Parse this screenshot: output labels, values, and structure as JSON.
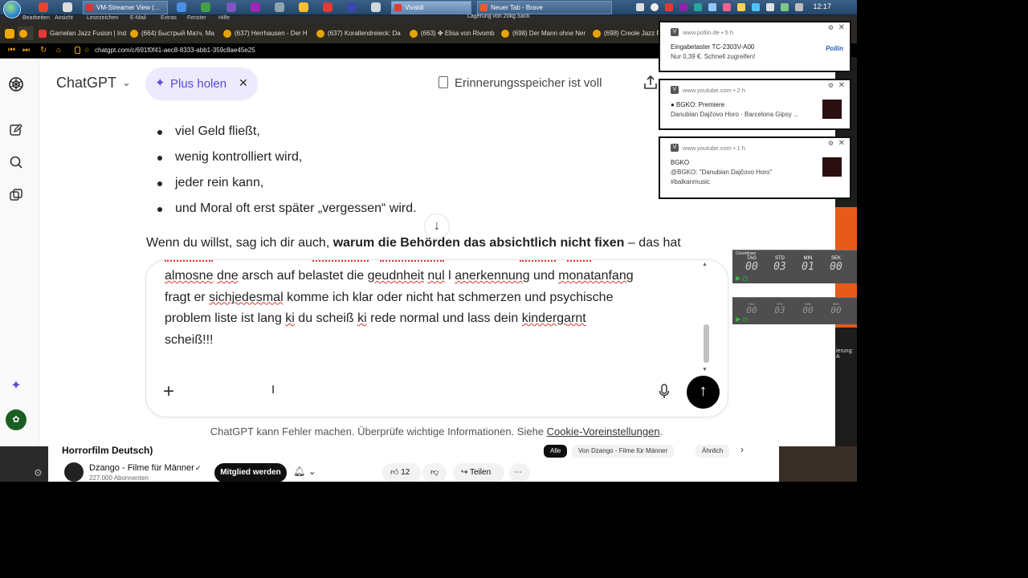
{
  "taskbar": {
    "tasks": [
      "VM-Streamer View (...",
      "Vivaldi",
      "Neuer Tab - Brave"
    ],
    "clock": "12:17",
    "window_title_snip": "Lagerung von 20kg Sack"
  },
  "menubar": {
    "items": [
      "Bearbeiten",
      "Ansicht",
      "Lesezeichen",
      "E-Mail",
      "Extras",
      "Fenster",
      "Hilfe"
    ]
  },
  "tabs": [
    "Gamelan Jazz Fusion | Ind",
    "(664) Быстрый Матч. Ma",
    "(637) Herrhausen - Der H",
    "(637) Korallendreieck: Da",
    "(663) ✤ Elisa von Rivomb",
    "(698) Der Mann ohne Ner",
    "(698) Creole Jazz F"
  ],
  "address": {
    "url": "chatgpt.com/c/691f0f41-aec8-8333-abb1-359c8ae45e25"
  },
  "chat": {
    "model_name": "ChatGPT",
    "plus_label": "Plus holen",
    "memory_label": "Erinnerungsspeicher ist voll",
    "bullets": [
      "viel Geld fließt,",
      "wenig kontrolliert wird,",
      "jeder rein kann,",
      "und Moral oft erst später „vergessen“ wird."
    ],
    "para_prefix": "Wenn du willst, sag ich dir auch, ",
    "para_bold": "warum die Behörden das absichtlich nicht fixen",
    "para_suffix": " – das hat",
    "input_lines": {
      "l1_a": "almosne",
      "l1_b": " ",
      "l1_c": "dne",
      "l1_d": " arsch auf belastet die ",
      "l1_e": "geudnheit",
      "l1_f": " ",
      "l1_g": "nul",
      "l1_h": " l ",
      "l1_i": "anerkennung",
      "l1_j": " und  ",
      "l1_k": "monatanfang",
      "l2_a": "fragt er ",
      "l2_b": "sichjedesmal",
      "l2_c": "  komme ich klar oder nicht  hat schmerzen und psychische",
      "l3_a": "problem liste ist lang ",
      "l3_b": "ki",
      "l3_c": " du scheiß ",
      "l3_d": "ki",
      "l3_e": " rede normal  und lass dein ",
      "l3_f": "kindergarnt",
      "l4": "scheiß!!!"
    },
    "disclaimer_prefix": "ChatGPT kann Fehler machen. Überprüfe wichtige Informationen. Siehe ",
    "disclaimer_link": "Cookie-Voreinstellungen",
    "disclaimer_suffix": "."
  },
  "youtube": {
    "title_snip": "Horrorfilm Deutsch)",
    "channel": "Dzango - Filme für Männer",
    "subscribers": "227.000 Abonnenten",
    "join_label": "Mitglied werden",
    "likes": "12",
    "share_label": "Teilen",
    "chips": [
      "Alle",
      "Von Dzango - Filme für Männer",
      "Ähnlich"
    ]
  },
  "notifications": [
    {
      "source": "www.pollin.de • 5 h",
      "line1": "Eingabetaster TC-2303V-A00",
      "line2": "Nur 0,39 €. Schnell zugreifen!",
      "line3": "",
      "logo": "Pollin"
    },
    {
      "source": "www.youtube.com • 2 h",
      "line1": "● BGKO: Premiere",
      "line2": "Danubian Dajčovo Horo · Barcelona Gipsy ...",
      "line3": ""
    },
    {
      "source": "www.youtube.com • 1 h",
      "line1": "BGKO",
      "line2": "@BGKO: \"Danubian Dajčovo Horo\"",
      "line3": "#balkanmusic"
    }
  ],
  "countdown": {
    "title": "Countdown",
    "labels": [
      "TAG",
      "STD",
      "MIN",
      "SEK"
    ],
    "values": [
      "00",
      "03",
      "01",
      "00"
    ],
    "values2": [
      "00",
      "03",
      "00",
      "00"
    ]
  },
  "snippets": {
    "ierung": "ierung: A"
  },
  "colors": {
    "plus_accent": "#5b4bd6",
    "send_bg": "#000000",
    "vivaldi_orange": "#f2a800"
  }
}
